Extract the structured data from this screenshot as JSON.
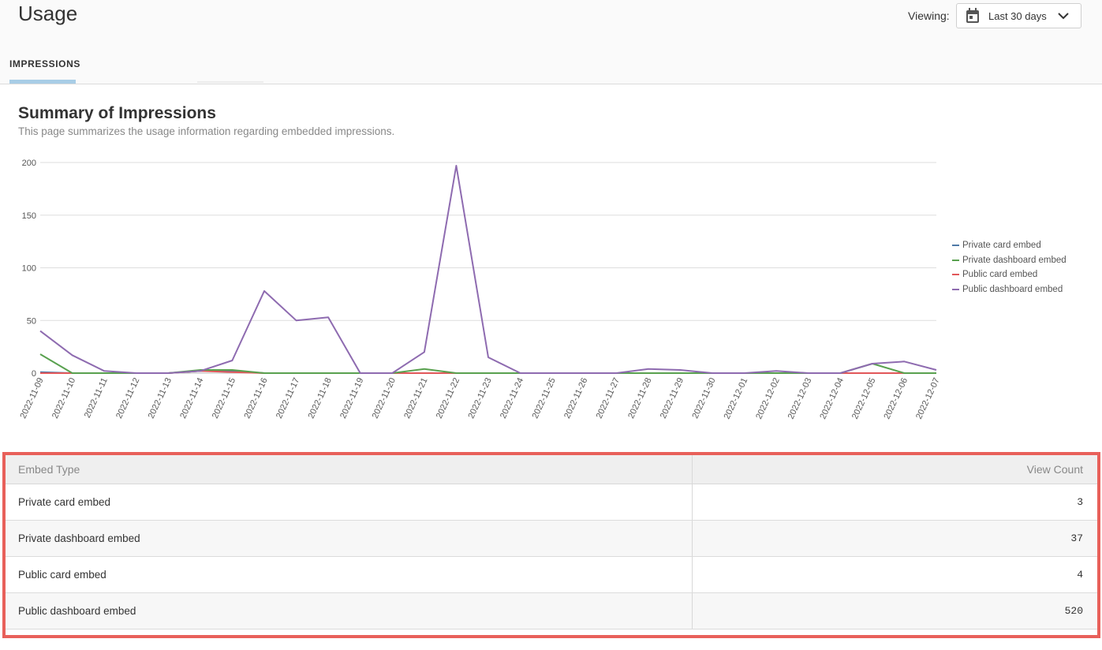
{
  "header": {
    "title": "Usage",
    "viewing_label": "Viewing:",
    "range": "Last 30 days"
  },
  "tabs": [
    {
      "label": "IMPRESSIONS",
      "active": true
    }
  ],
  "summary": {
    "title": "Summary of Impressions",
    "subtitle": "This page summarizes the usage information regarding embedded impressions."
  },
  "chart_data": {
    "type": "line",
    "x": [
      "2022-11-09",
      "2022-11-10",
      "2022-11-11",
      "2022-11-12",
      "2022-11-13",
      "2022-11-14",
      "2022-11-15",
      "2022-11-16",
      "2022-11-17",
      "2022-11-18",
      "2022-11-19",
      "2022-11-20",
      "2022-11-21",
      "2022-11-22",
      "2022-11-23",
      "2022-11-24",
      "2022-11-25",
      "2022-11-26",
      "2022-11-27",
      "2022-11-28",
      "2022-11-29",
      "2022-11-30",
      "2022-12-01",
      "2022-12-02",
      "2022-12-03",
      "2022-12-04",
      "2022-12-05",
      "2022-12-06",
      "2022-12-07"
    ],
    "ylim": [
      0,
      200
    ],
    "yticks": [
      0,
      50,
      100,
      150,
      200
    ],
    "grid": true,
    "legend": "right",
    "series": [
      {
        "name": "Private card embed",
        "color": "#4e79a7",
        "values": [
          1,
          0,
          0,
          0,
          0,
          2,
          2,
          0,
          0,
          0,
          0,
          0,
          0,
          0,
          0,
          0,
          0,
          0,
          0,
          0,
          0,
          0,
          0,
          0,
          0,
          0,
          0,
          0,
          0
        ]
      },
      {
        "name": "Private dashboard embed",
        "color": "#59a14f",
        "values": [
          18,
          0,
          0,
          0,
          0,
          3,
          3,
          0,
          0,
          0,
          0,
          0,
          4,
          0,
          0,
          0,
          0,
          0,
          0,
          0,
          0,
          0,
          0,
          0,
          0,
          0,
          9,
          0,
          0
        ]
      },
      {
        "name": "Public card embed",
        "color": "#e15759",
        "values": [
          0,
          0,
          0,
          0,
          0,
          2,
          1,
          0,
          0,
          0,
          0,
          0,
          0,
          0,
          0,
          0,
          0,
          0,
          0,
          0,
          0,
          0,
          0,
          0,
          0,
          0,
          0,
          0,
          0
        ]
      },
      {
        "name": "Public dashboard embed",
        "color": "#8e6bb0",
        "values": [
          40,
          17,
          2,
          0,
          0,
          2,
          12,
          78,
          50,
          53,
          0,
          0,
          20,
          197,
          15,
          0,
          0,
          0,
          0,
          4,
          3,
          0,
          0,
          2,
          0,
          0,
          9,
          11,
          3
        ]
      }
    ]
  },
  "table": {
    "columns": [
      "Embed Type",
      "View Count"
    ],
    "rows": [
      [
        "Private card embed",
        "3"
      ],
      [
        "Private dashboard embed",
        "37"
      ],
      [
        "Public card embed",
        "4"
      ],
      [
        "Public dashboard embed",
        "520"
      ]
    ]
  }
}
